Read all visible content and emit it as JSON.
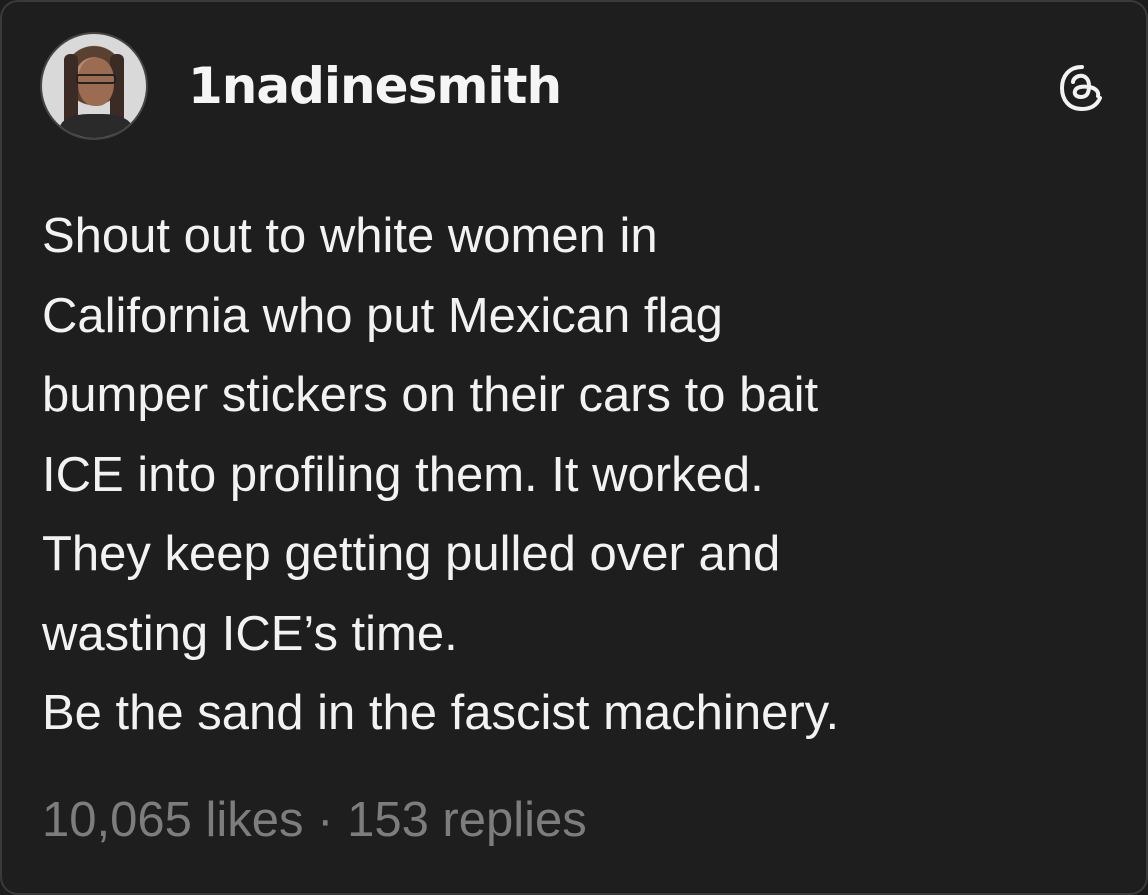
{
  "post": {
    "username": "1nadinesmith",
    "icons": {
      "avatar": "profile-photo",
      "platform": "threads-logo-icon"
    },
    "lines": [
      "Shout out to white women in",
      "California who put Mexican flag",
      "bumper stickers on their cars to bait",
      "ICE into profiling them. It worked.",
      "They keep getting pulled over and",
      "wasting ICE’s time.",
      "Be the sand in the fascist machinery."
    ],
    "stats": {
      "likes": "10,065 likes",
      "separator": " · ",
      "replies": "153 replies"
    }
  },
  "colors": {
    "background": "#1e1e1e",
    "text": "#f2f2f2",
    "muted": "#7d7d7d"
  }
}
